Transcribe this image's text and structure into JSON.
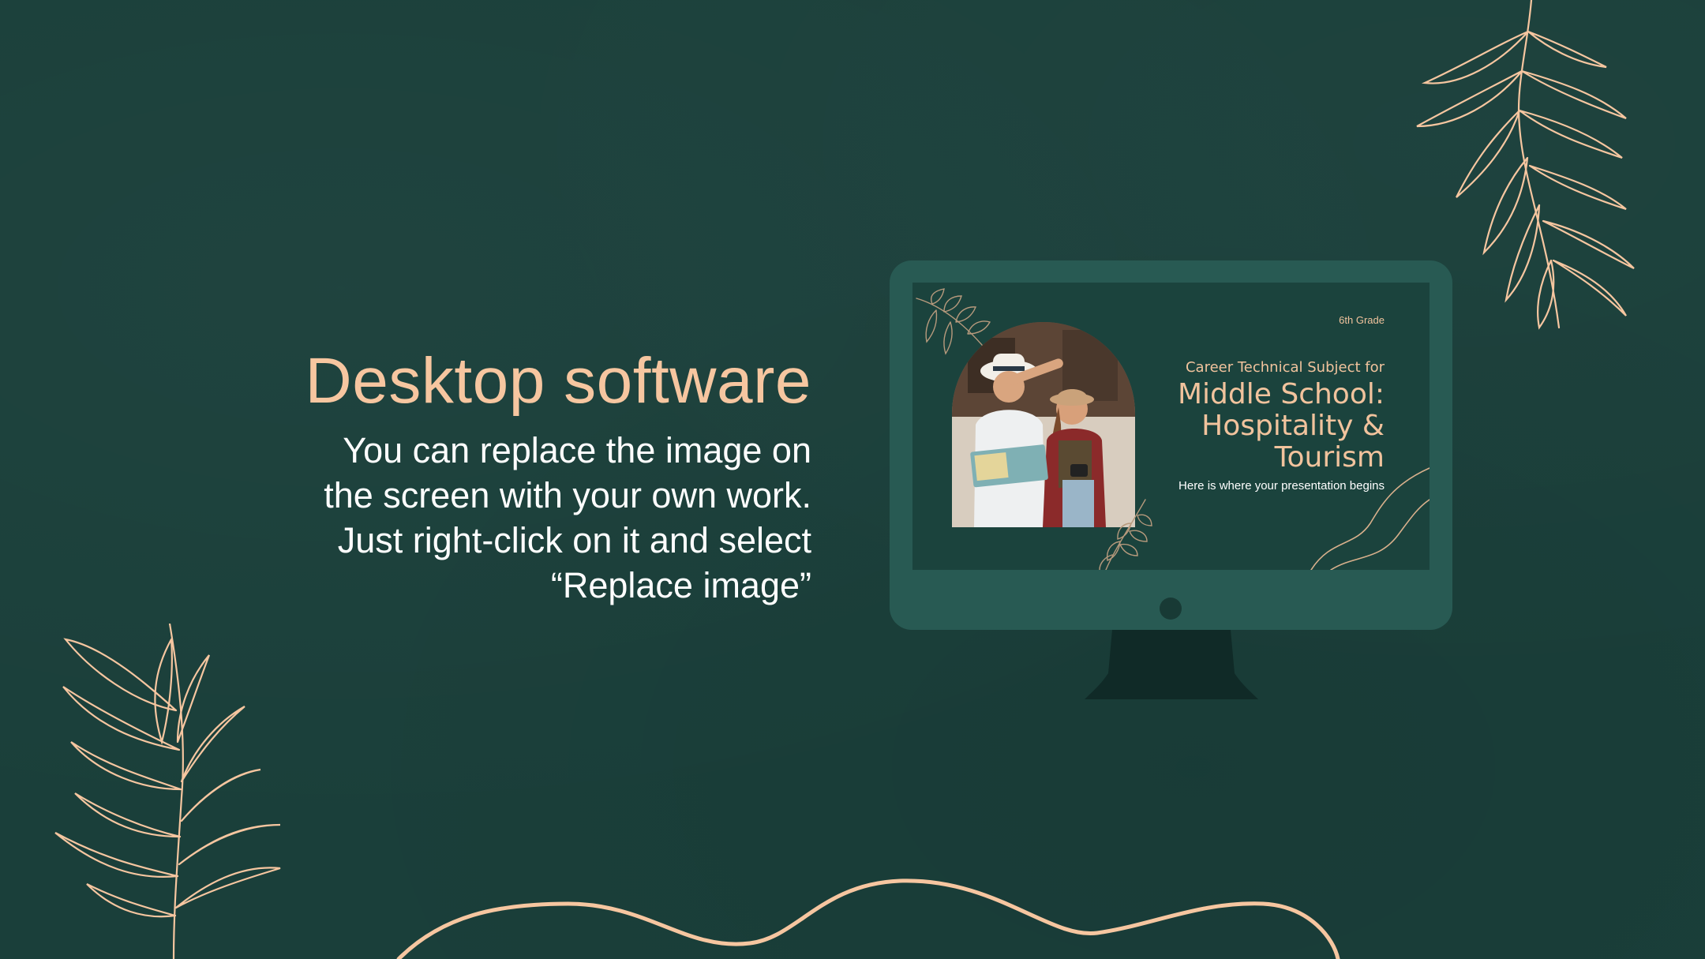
{
  "slide": {
    "title": "Desktop software",
    "body": "You can replace the image on\nthe screen with your own work.\nJust right-click on it and select\n“Replace image”"
  },
  "screen": {
    "grade": "6th Grade",
    "subject": "Career Technical Subject for",
    "title": "Middle School:\nHospitality &\nTourism",
    "tagline": "Here is where your presentation begins"
  },
  "colors": {
    "background": "#1a3f3a",
    "accent": "#f6c6a0",
    "monitor": "#285a53",
    "text": "#ffffff"
  },
  "icons": {
    "top_right": "leaf-branch-icon",
    "bottom_left": "leaf-branch-icon",
    "bottom": "wave-line"
  }
}
